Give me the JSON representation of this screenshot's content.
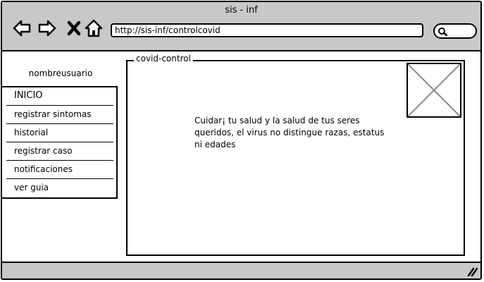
{
  "window": {
    "title": "sis - inf"
  },
  "toolbar": {
    "url": "http://sis-inf/controlcovid",
    "icons": [
      "back-arrow-icon",
      "forward-arrow-icon",
      "close-x-icon",
      "home-icon",
      "search-icon"
    ]
  },
  "sidebar": {
    "username": "nombreusuario",
    "items": [
      {
        "label": "INICIO"
      },
      {
        "label": "registrar sintomas"
      },
      {
        "label": "historial"
      },
      {
        "label": "registrar caso"
      },
      {
        "label": "notificaciones"
      },
      {
        "label": "ver guia"
      }
    ]
  },
  "main": {
    "legend": "covid-control",
    "message": "Cuidar¡ tu salud y la salud de tus seres queridos, el virus no distingue razas, estatus ni edades",
    "image_placeholder": "image-placeholder-icon"
  },
  "colors": {
    "chrome": "#c8c8c8",
    "border": "#000000",
    "background": "#ffffff"
  }
}
